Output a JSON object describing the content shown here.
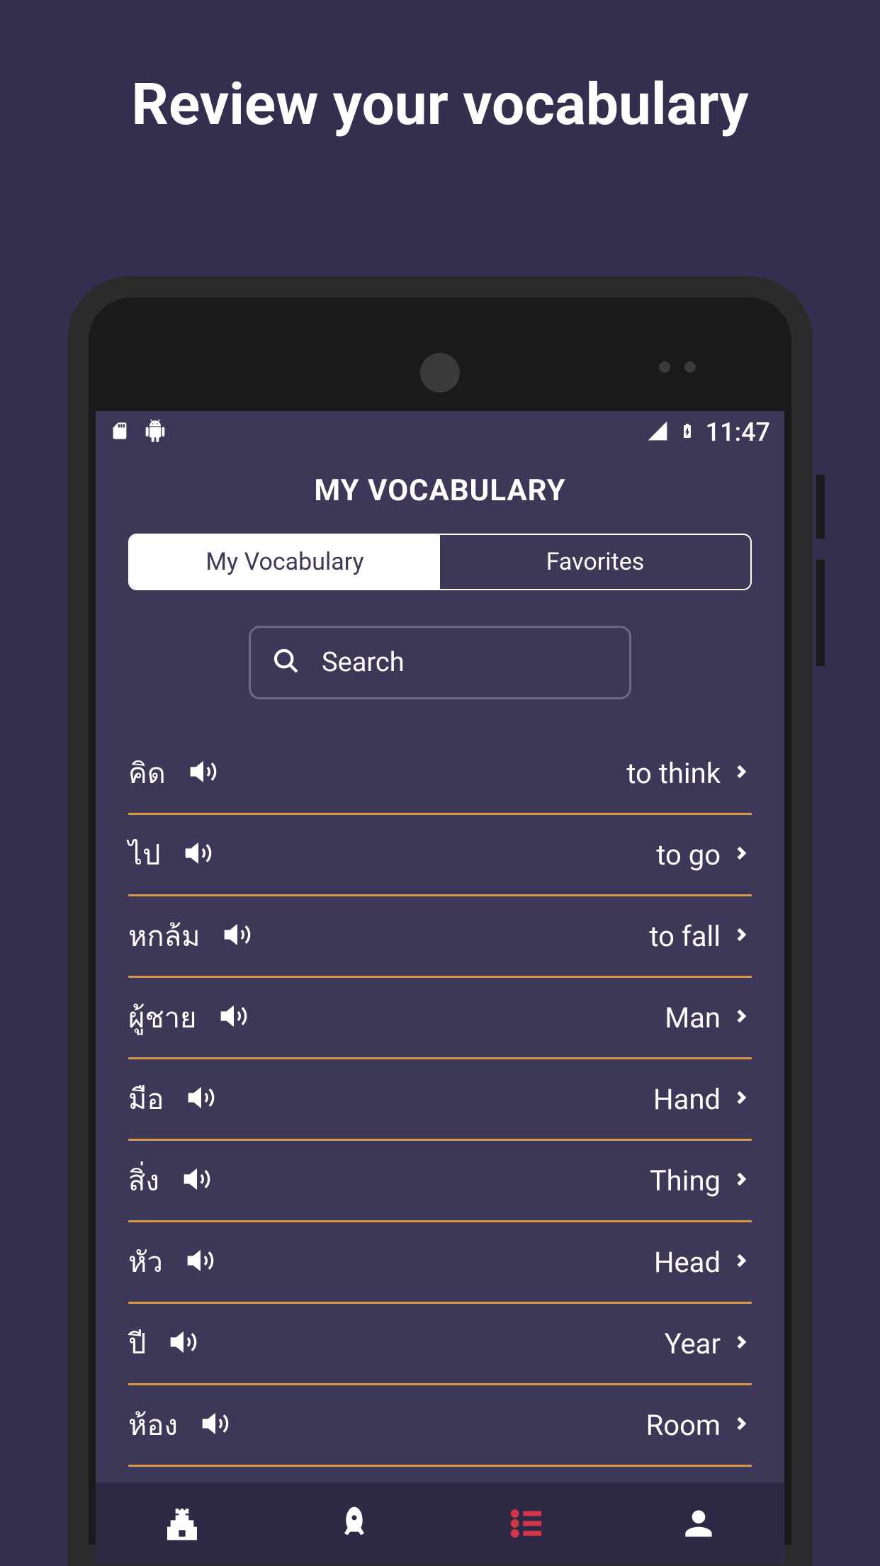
{
  "promo": {
    "title": "Review your vocabulary"
  },
  "statusBar": {
    "time": "11:47"
  },
  "header": {
    "title": "MY VOCABULARY"
  },
  "tabs": {
    "myVocabulary": "My Vocabulary",
    "favorites": "Favorites"
  },
  "search": {
    "placeholder": "Search"
  },
  "vocabulary": [
    {
      "source": "คิด",
      "target": "to think"
    },
    {
      "source": "ไป",
      "target": "to go"
    },
    {
      "source": "หกล้ม",
      "target": "to fall"
    },
    {
      "source": "ผู้ชาย",
      "target": "Man"
    },
    {
      "source": "มือ",
      "target": "Hand"
    },
    {
      "source": "สิ่ง",
      "target": "Thing"
    },
    {
      "source": "หัว",
      "target": "Head"
    },
    {
      "source": "ปี",
      "target": "Year"
    },
    {
      "source": "ห้อง",
      "target": "Room"
    }
  ]
}
